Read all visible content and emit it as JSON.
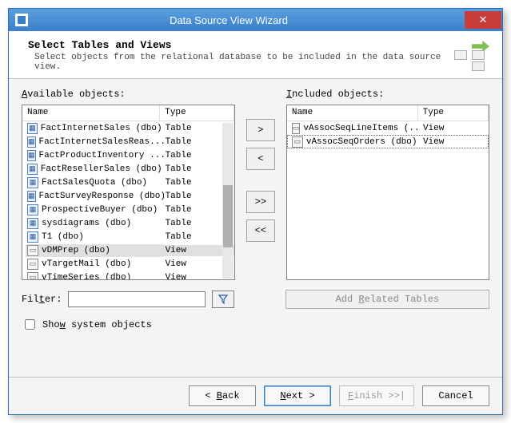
{
  "window": {
    "title": "Data Source View Wizard"
  },
  "header": {
    "title": "Select Tables and Views",
    "subtitle": "Select objects from the relational database to be included in the data source view."
  },
  "labels": {
    "available": "Available objects:",
    "available_key": "A",
    "included": "Included objects:",
    "included_key": "I",
    "col_name": "Name",
    "col_type": "Type",
    "filter": "Filter:",
    "filter_key": "t",
    "show_system": "Show system objects",
    "show_system_key": "w",
    "add_related": "Add Related Tables",
    "add_related_key": "R"
  },
  "move_buttons": {
    "add": ">",
    "remove": "<",
    "add_all": ">>",
    "remove_all": "<<"
  },
  "footer": {
    "back": "< Back",
    "next": "Next >",
    "finish": "Finish >>|",
    "cancel": "Cancel"
  },
  "available_objects": [
    {
      "name": "FactInternetSales (dbo)",
      "type": "Table",
      "icon": "table"
    },
    {
      "name": "FactInternetSalesReas...",
      "type": "Table",
      "icon": "table"
    },
    {
      "name": "FactProductInventory ...",
      "type": "Table",
      "icon": "table"
    },
    {
      "name": "FactResellerSales (dbo)",
      "type": "Table",
      "icon": "table"
    },
    {
      "name": "FactSalesQuota (dbo)",
      "type": "Table",
      "icon": "table"
    },
    {
      "name": "FactSurveyResponse (dbo)",
      "type": "Table",
      "icon": "table"
    },
    {
      "name": "ProspectiveBuyer (dbo)",
      "type": "Table",
      "icon": "table"
    },
    {
      "name": "sysdiagrams (dbo)",
      "type": "Table",
      "icon": "table"
    },
    {
      "name": "T1 (dbo)",
      "type": "Table",
      "icon": "table"
    },
    {
      "name": "vDMPrep (dbo)",
      "type": "View",
      "icon": "view",
      "selected": true
    },
    {
      "name": "vTargetMail (dbo)",
      "type": "View",
      "icon": "view"
    },
    {
      "name": "vTimeSeries (dbo)",
      "type": "View",
      "icon": "view"
    }
  ],
  "included_objects": [
    {
      "name": "vAssocSeqLineItems (...",
      "type": "View",
      "icon": "view"
    },
    {
      "name": "vAssocSeqOrders (dbo)",
      "type": "View",
      "icon": "view",
      "focused": true
    }
  ],
  "filter_value": "",
  "show_system_checked": false,
  "colors": {
    "titlebar": "#3a7fc8",
    "close": "#c93c3c",
    "accent": "#2a5aaa"
  }
}
